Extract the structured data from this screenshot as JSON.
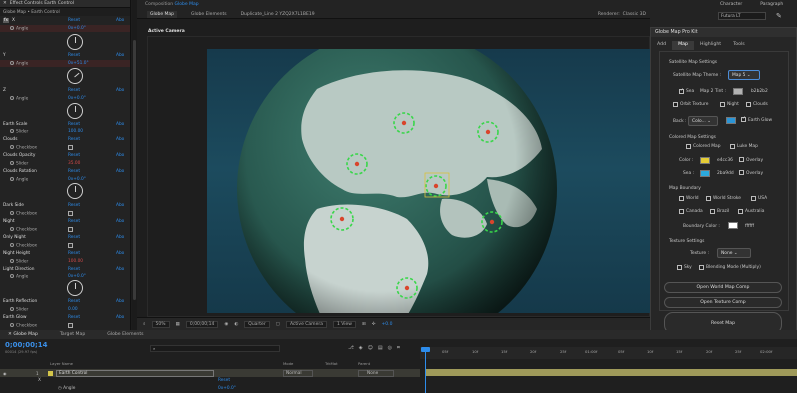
{
  "effect_controls": {
    "tab_label": "Effect Controls",
    "tab_target": "Earth Control",
    "breadcrumb": "Globe Map • Earth Control",
    "header_fx": "fx",
    "rows": [
      {
        "name": "X",
        "reset": "Reset",
        "about": "Abo"
      },
      {
        "sub": "Angle",
        "value": "0x+0.0°"
      },
      {
        "name": "Y",
        "reset": "Reset",
        "about": "Abo"
      },
      {
        "sub": "Angle",
        "value": "0x+51.0°"
      },
      {
        "name": "Z",
        "reset": "Reset",
        "about": "Abo"
      },
      {
        "sub": "Angle",
        "value": "0x+0.0°"
      },
      {
        "name": "Earth Scale",
        "reset": "Reset",
        "about": "Abo"
      },
      {
        "sub": "Slider",
        "value": "100.00"
      },
      {
        "name": "Clouds",
        "reset": "Reset",
        "about": "Abo"
      },
      {
        "sub": "Checkbox"
      },
      {
        "name": "Clouds Opacity",
        "reset": "Reset",
        "about": "Abo"
      },
      {
        "sub": "Slider",
        "value": "35.00"
      },
      {
        "name": "Clouds Rotation",
        "reset": "Reset",
        "about": "Abo"
      },
      {
        "sub": "Angle",
        "value": "0x+0.0°"
      },
      {
        "name": "Dark Side",
        "reset": "Reset",
        "about": "Abo"
      },
      {
        "sub": "Checkbox"
      },
      {
        "name": "Night",
        "reset": "Reset",
        "about": "Abo"
      },
      {
        "sub": "Checkbox"
      },
      {
        "name": "Only Night",
        "reset": "Reset",
        "about": "Abo"
      },
      {
        "sub": "Checkbox"
      },
      {
        "name": "Night Height",
        "reset": "Reset",
        "about": "Abo"
      },
      {
        "sub": "Slider",
        "value": "100.00"
      },
      {
        "name": "Light Direction",
        "reset": "Reset",
        "about": "Abo"
      },
      {
        "sub": "Angle",
        "value": "0x+0.0°"
      },
      {
        "name": "Earth Reflection",
        "reset": "Reset",
        "about": "Abo"
      },
      {
        "sub": "Slider",
        "value": "0.00"
      },
      {
        "name": "Earth Glow",
        "reset": "Reset",
        "about": "Abo"
      },
      {
        "sub": "Checkbox"
      }
    ]
  },
  "composition": {
    "tab_prefix": "Composition",
    "tab_name": "Globe Map",
    "subtabs": [
      "Globe Map",
      "Globe Elements",
      "Duplicate_Line 2 YZQ2X7L1BE19"
    ],
    "renderer_label": "Renderer:",
    "renderer_value": "Classic 3D",
    "active_camera": "Active Camera",
    "footer": {
      "zoom": "50%",
      "timecode": "0;00;00;14",
      "resolution": "Quarter",
      "camera": "Active Camera",
      "view": "1 View",
      "exposure": "+0.0"
    }
  },
  "character_panel": {
    "tabs": [
      "Character",
      "Paragraph"
    ],
    "font": "Futura LT"
  },
  "globe_kit": {
    "title": "Globe Map Pro Kit",
    "tabs": [
      "Add",
      "Map",
      "Highlight",
      "Tools"
    ],
    "active_tab": "Map",
    "satellite_settings_title": "Satellite Map Settings",
    "satellite_theme_label": "Satellite Map Theme :",
    "satellite_theme_value": "Map 5",
    "sea_label": "Sea",
    "map2_tint_label": "Map 2 Tint :",
    "map2_tint_value": "b2b2b2",
    "orbit_texture": "Orbit Texture",
    "night": "Night",
    "clouds": "Clouds",
    "back_label": "Back :",
    "back_value": "Colo...",
    "earth_glow": "Earth Glow",
    "colored_map_settings_title": "Colored Map Settings",
    "colored_map": "Colored Map",
    "luke_map": "Luke Map",
    "color_label": "Color :",
    "color_value": "e4cc36",
    "overlay_1": "Overlay",
    "sea_label_2": "Sea :",
    "sea_color_value": "2ba9dd",
    "overlay_2": "Overlay",
    "map_boundary_title": "Map Boundary",
    "world": "World",
    "world_stroke": "World Stroke",
    "usa": "USA",
    "canada": "Canada",
    "brazil": "Brazil",
    "australia": "Australia",
    "boundary_color_label": "Boundary Color :",
    "boundary_color_value": "ffffff",
    "texture_settings_title": "Texture Settings",
    "texture_label": "Texture :",
    "texture_value": "None",
    "sky": "Sky",
    "blending_mode": "Blending Mode (Multiply)",
    "btn_open_world": "Open World Map Comp",
    "btn_open_texture": "Open Texture Comp",
    "btn_reset": "Reset Map",
    "colors": {
      "tint": "#b2b2b2",
      "color": "#e4cc36",
      "sea": "#2ba9dd",
      "boundary": "#ffffff",
      "back": "#2b95d6"
    }
  },
  "timeline": {
    "tabs": [
      "Globe Map",
      "Target Map",
      "Globe Elements"
    ],
    "timecode": "0;00;00;14",
    "fps": "00014 (29.97 fps)",
    "col_layer_name": "Layer Name",
    "col_mode": "Mode",
    "col_trkmat": "TrkMat",
    "col_parent": "Parent",
    "layer_num": "1",
    "layer_name": "Earth Control",
    "layer_mode": "Normal",
    "layer_parent": "None",
    "sub_fx": "X",
    "sub_reset": "Reset",
    "sub_angle": "Angle",
    "sub_angle_value": "0x+0.0°",
    "ticks": [
      "05f",
      "10f",
      "15f",
      "20f",
      "25f",
      "01:00f",
      "05f",
      "10f",
      "15f",
      "20f",
      "25f",
      "02:00f"
    ]
  }
}
